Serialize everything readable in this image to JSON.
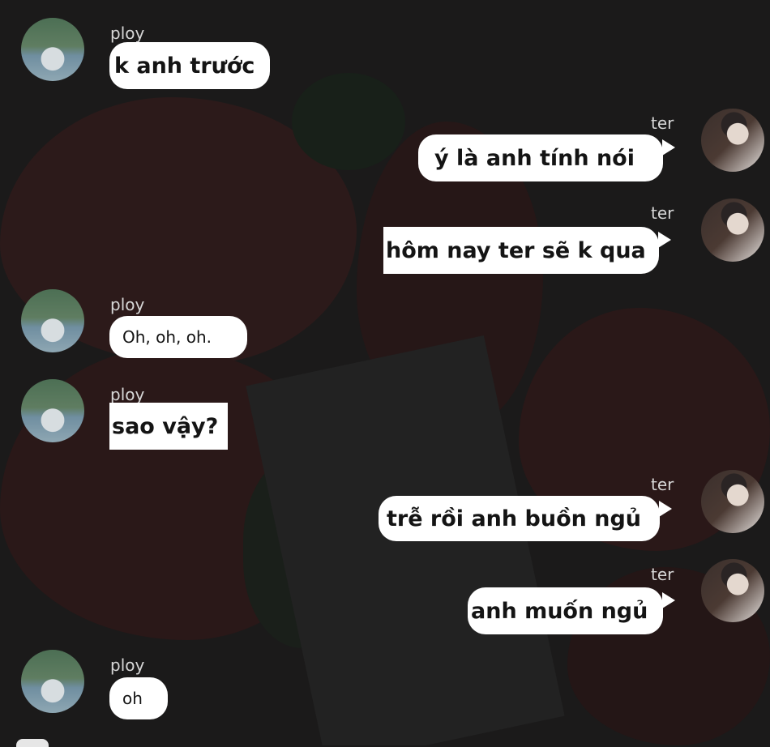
{
  "messages": [
    {
      "sender": "ploy",
      "text": "k anh trước"
    },
    {
      "sender": "ter",
      "text": "ý là anh tính nói"
    },
    {
      "sender": "ter",
      "text": "hôm nay ter sẽ k qua"
    },
    {
      "sender": "ploy",
      "text": "Oh, oh, oh."
    },
    {
      "sender": "ploy",
      "text": "sao vậy?"
    },
    {
      "sender": "ter",
      "text": "trễ rồi anh buồn ngủ"
    },
    {
      "sender": "ter",
      "text": "anh muốn ngủ"
    },
    {
      "sender": "ploy",
      "text": "oh"
    }
  ],
  "colors": {
    "bubble": "#ffffff",
    "text": "#141414",
    "name": "#d7d7d7",
    "background": "#1b1a1a"
  }
}
